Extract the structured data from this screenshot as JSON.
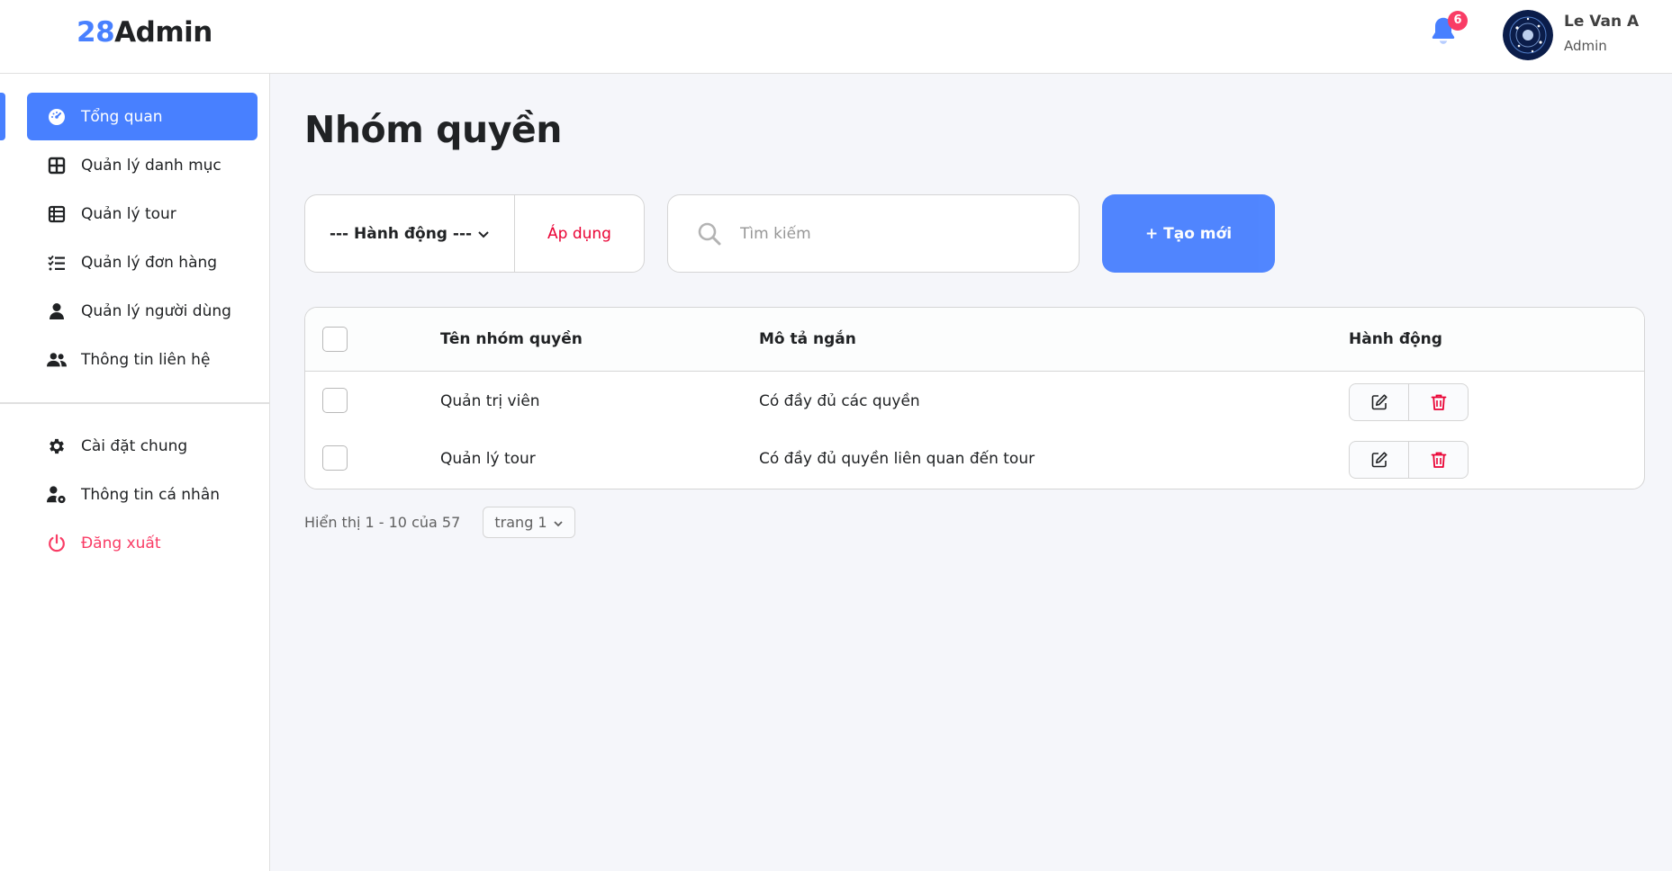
{
  "header": {
    "logo_accent": "28",
    "logo_text": "Admin",
    "notification_count": "6",
    "user_name": "Le Van A",
    "user_role": "Admin"
  },
  "sidebar": {
    "items": [
      {
        "label": "Tổng quan",
        "icon": "dashboard-icon",
        "active": true
      },
      {
        "label": "Quản lý danh mục",
        "icon": "grid-icon"
      },
      {
        "label": "Quản lý tour",
        "icon": "table-icon"
      },
      {
        "label": "Quản lý đơn hàng",
        "icon": "checklist-icon"
      },
      {
        "label": "Quản lý người dùng",
        "icon": "user-icon"
      },
      {
        "label": "Thông tin liên hệ",
        "icon": "users-icon"
      }
    ],
    "bottom_items": [
      {
        "label": "Cài đặt chung",
        "icon": "gear-icon"
      },
      {
        "label": "Thông tin cá nhân",
        "icon": "user-gear-icon"
      },
      {
        "label": "Đăng xuất",
        "icon": "power-icon",
        "color": "#f93c65"
      }
    ]
  },
  "main": {
    "title": "Nhóm quyền",
    "action_select_label": "--- Hành động ---",
    "apply_label": "Áp dụng",
    "search_placeholder": "Tìm kiếm",
    "create_label": "+ Tạo mới",
    "table": {
      "headers": [
        "Tên nhóm quyền",
        "Mô tả ngắn",
        "Hành động"
      ],
      "rows": [
        {
          "name": "Quản trị viên",
          "desc": "Có đầy đủ các quyền"
        },
        {
          "name": "Quản lý tour",
          "desc": "Có đầy đủ quyền liên quan đến tour"
        }
      ]
    },
    "pagination": {
      "info": "Hiển thị 1 - 10 của 57",
      "page_label": "trang 1"
    }
  },
  "colors": {
    "primary": "#4880ff",
    "danger": "#ea0234",
    "badge": "#f93c65"
  }
}
